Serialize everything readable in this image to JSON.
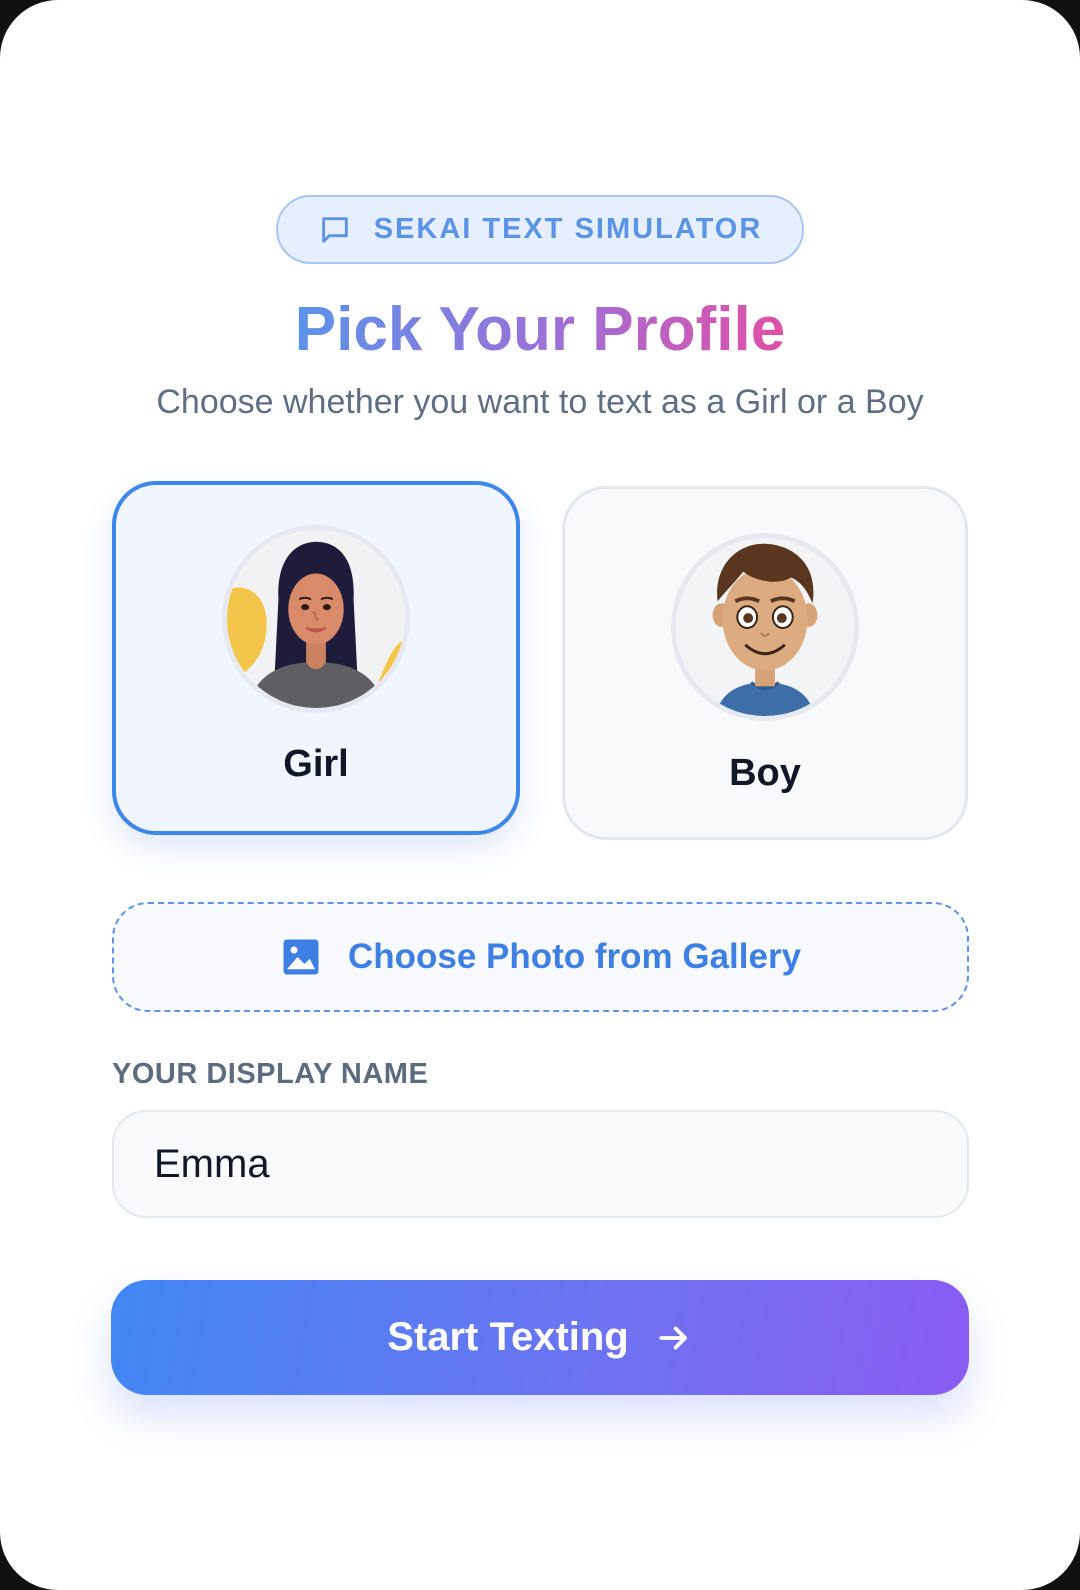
{
  "header": {
    "badge": {
      "icon": "chat-bubble-icon",
      "label": "SEKAI TEXT SIMULATOR"
    },
    "title": "Pick Your Profile",
    "subtitle": "Choose whether you want to text as a Girl or a Boy"
  },
  "profiles": {
    "selected": "girl",
    "options": [
      {
        "id": "girl",
        "label": "Girl",
        "avatar": "girl-avatar"
      },
      {
        "id": "boy",
        "label": "Boy",
        "avatar": "boy-avatar"
      }
    ]
  },
  "gallery": {
    "icon": "image-icon",
    "label": "Choose Photo from Gallery"
  },
  "display_name": {
    "label": "YOUR DISPLAY NAME",
    "value": "Emma",
    "placeholder": ""
  },
  "start_button": {
    "label": "Start Texting",
    "icon": "arrow-right-icon"
  },
  "colors": {
    "accent": "#3f86ea",
    "gradient_start": "#4286f4",
    "gradient_end": "#8a5cf2",
    "title_gradient": [
      "#5b93ea",
      "#a06fd6",
      "#e14fa6"
    ]
  }
}
